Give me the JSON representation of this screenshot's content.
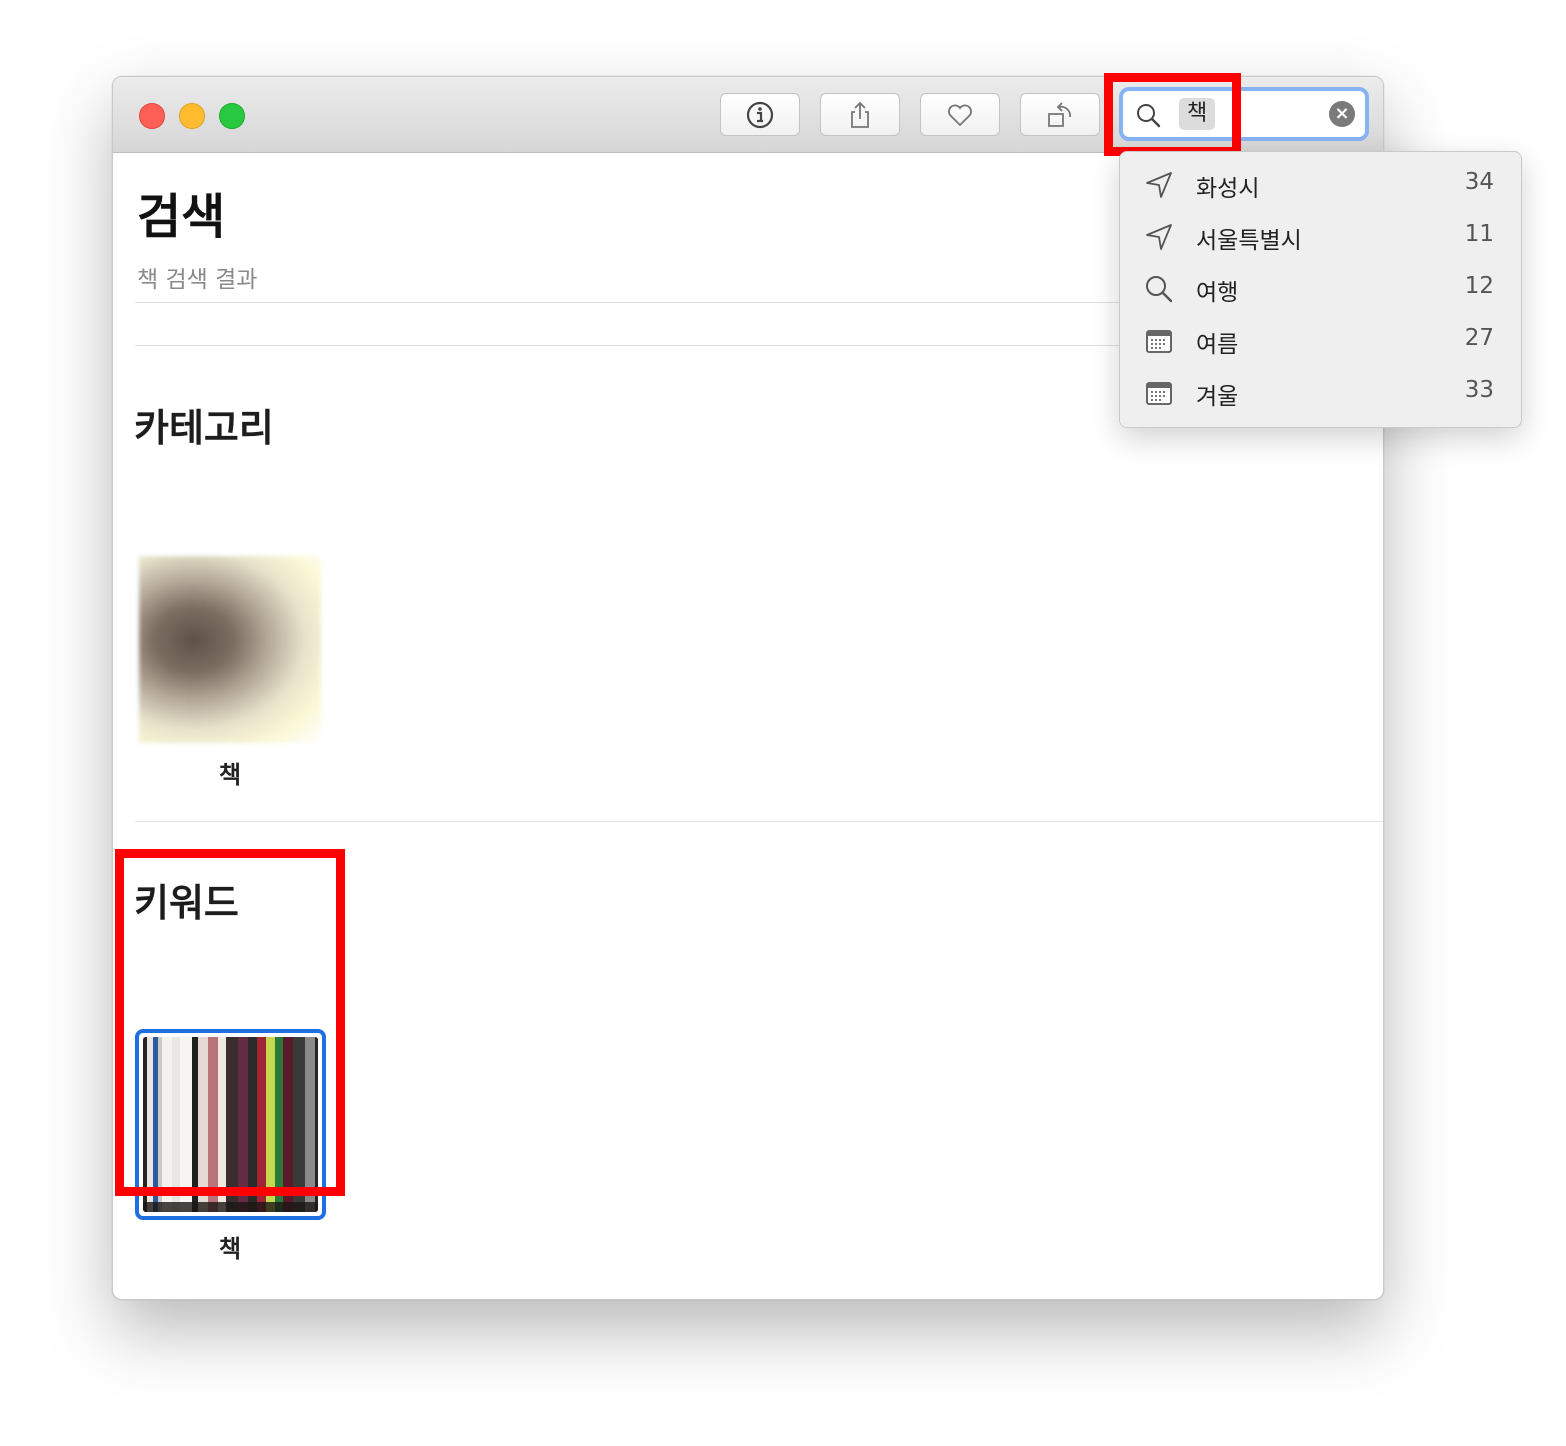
{
  "toolbar": {
    "buttons": [
      {
        "name": "info-button",
        "icon": "info-icon"
      },
      {
        "name": "share-button",
        "icon": "share-icon"
      },
      {
        "name": "favorite-button",
        "icon": "heart-icon"
      },
      {
        "name": "rotate-button",
        "icon": "rotate-icon"
      }
    ]
  },
  "search": {
    "token": "책",
    "icon": "search-icon",
    "clear_icon": "clear-icon"
  },
  "page": {
    "title": "검색",
    "subtitle": "책 검색 결과"
  },
  "sections": {
    "category": {
      "title": "카테고리",
      "item_label": "책"
    },
    "keyword": {
      "title": "키워드",
      "item_label": "책"
    }
  },
  "suggestions": [
    {
      "icon": "location-arrow-icon",
      "label": "화성시",
      "count": "34"
    },
    {
      "icon": "location-arrow-icon",
      "label": "서울특별시",
      "count": "11"
    },
    {
      "icon": "search-icon",
      "label": "여행",
      "count": "12"
    },
    {
      "icon": "calendar-icon",
      "label": "여름",
      "count": "27"
    },
    {
      "icon": "calendar-icon",
      "label": "겨울",
      "count": "33"
    }
  ],
  "colors": {
    "highlight": "#ff0000",
    "selection": "#1f6fe0",
    "search_focus": "#87b3f3"
  }
}
